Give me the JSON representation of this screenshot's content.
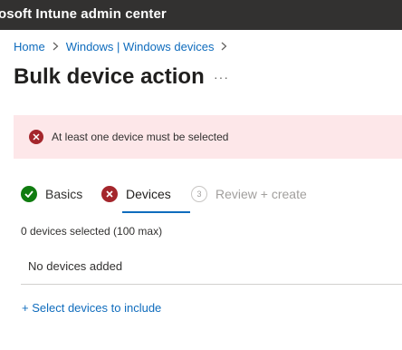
{
  "header": {
    "app_title": "osoft Intune admin center"
  },
  "breadcrumb": {
    "items": [
      "Home",
      "Windows | Windows devices"
    ]
  },
  "page": {
    "title": "Bulk device action",
    "more_label": "···"
  },
  "error_banner": {
    "message": "At least one device must be selected"
  },
  "wizard": {
    "steps": [
      {
        "label": "Basics",
        "status": "complete"
      },
      {
        "label": "Devices",
        "status": "error"
      },
      {
        "label": "Review + create",
        "status": "pending",
        "number": "3"
      }
    ]
  },
  "devices": {
    "selected_text": "0 devices selected (100 max)",
    "empty_text": "No devices added",
    "select_link": "+ Select devices to include"
  },
  "colors": {
    "accent": "#0f6cbd",
    "error": "#a4262c",
    "success": "#107c10",
    "topbar": "#323130",
    "error_bg": "#fde7e9"
  }
}
